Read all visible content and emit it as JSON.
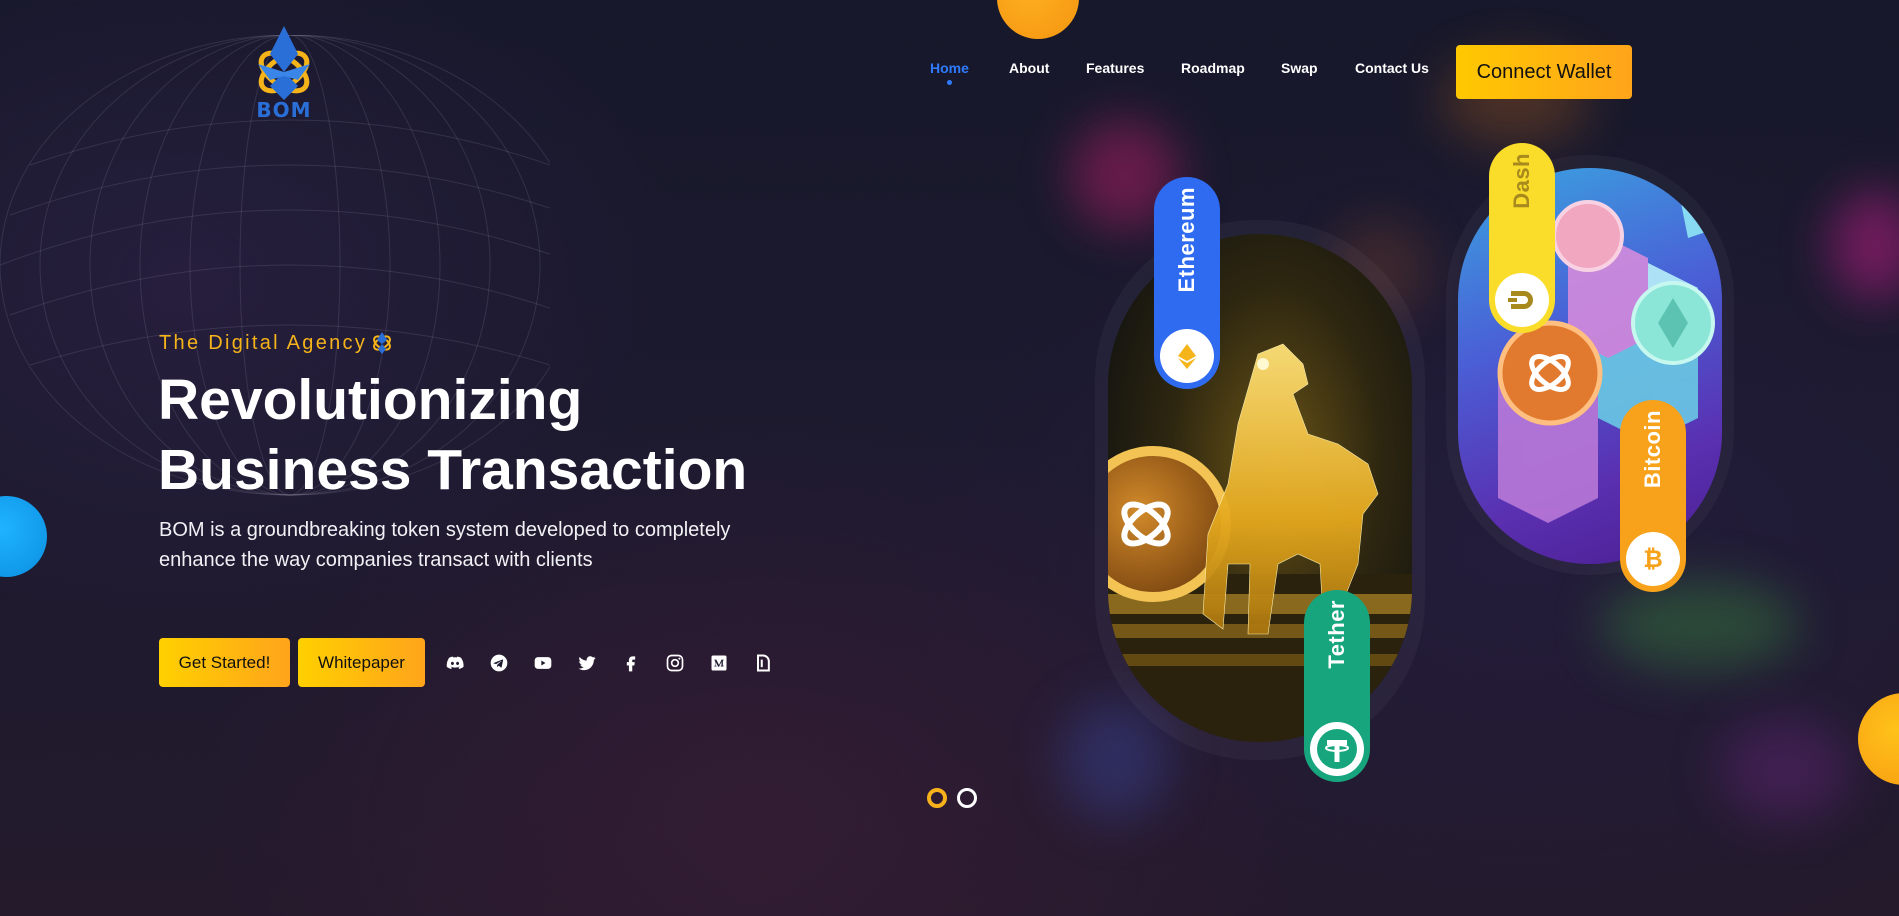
{
  "brand": {
    "logo_text": "BOM",
    "accent": "#f5b41a",
    "nav_active": "#2e7bff"
  },
  "nav": {
    "items": [
      {
        "label": "Home",
        "active": true
      },
      {
        "label": "About"
      },
      {
        "label": "Features"
      },
      {
        "label": "Roadmap"
      },
      {
        "label": "Swap"
      },
      {
        "label": "Contact Us"
      }
    ],
    "connect_label": "Connect Wallet"
  },
  "hero": {
    "tagline": "The Digital Agency",
    "headline_line1": "Revolutionizing",
    "headline_line2": "Business Transaction",
    "subtitle": "BOM is a groundbreaking token system developed to completely enhance the way companies transact with clients",
    "get_started": "Get Started!",
    "whitepaper": "Whitepaper"
  },
  "social": [
    "discord-icon",
    "telegram-icon",
    "youtube-icon",
    "twitter-icon",
    "facebook-icon",
    "instagram-icon",
    "medium-icon",
    "dextools-icon"
  ],
  "carousel": {
    "active_index": 0,
    "count": 2
  },
  "coins": {
    "ethereum": "Ethereum",
    "tether": "Tether",
    "dash": "Dash",
    "bitcoin": "Bitcoin"
  }
}
